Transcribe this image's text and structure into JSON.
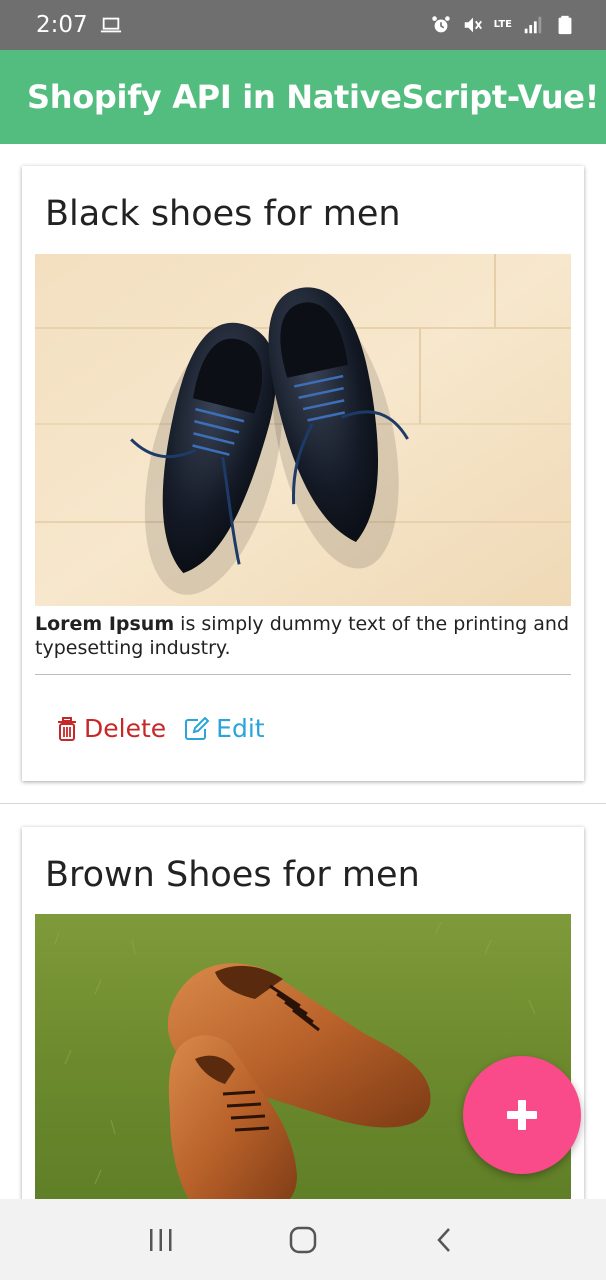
{
  "status_bar": {
    "time": "2:07",
    "network_label": "LTE",
    "icons": [
      "laptop-icon",
      "alarm-icon",
      "mute-icon",
      "lte-signal-icon",
      "signal-icon",
      "battery-icon"
    ]
  },
  "app_bar": {
    "title": "Shopify API in NativeScript-Vue!",
    "color": "#53bd7f"
  },
  "products": [
    {
      "title": "Black shoes for men",
      "image": "black-leather-shoes-photo",
      "description_bold": "Lorem Ipsum",
      "description_rest": " is simply dummy text of the printing and typesetting industry.",
      "delete_label": "Delete",
      "edit_label": "Edit"
    },
    {
      "title": "Brown Shoes for men",
      "image": "brown-leather-shoes-on-grass-photo"
    }
  ],
  "colors": {
    "delete": "#c62828",
    "edit": "#2aa4d9",
    "fab": "#f94b8a"
  },
  "fab": {
    "icon": "plus-icon"
  },
  "nav_bar": {
    "icons": [
      "recent-apps-icon",
      "home-icon",
      "back-icon"
    ]
  }
}
